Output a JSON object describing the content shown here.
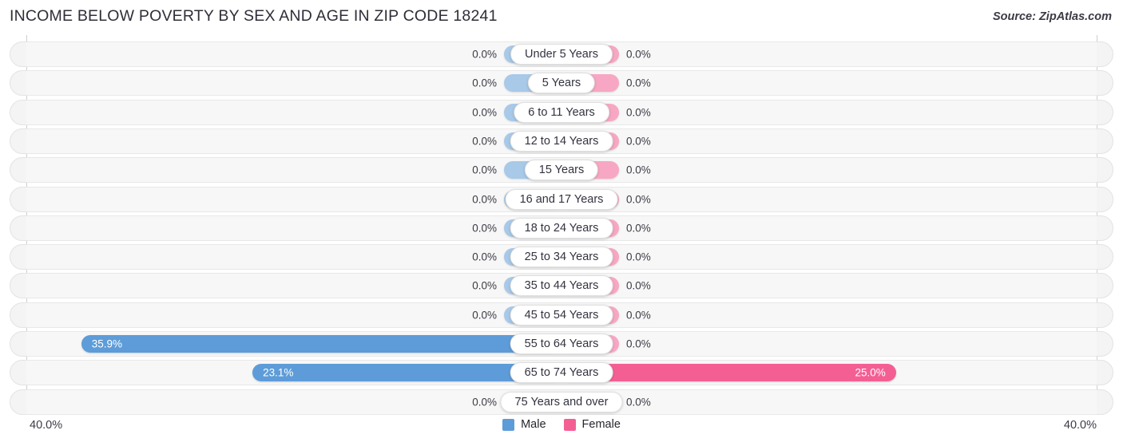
{
  "header": {
    "title": "INCOME BELOW POVERTY BY SEX AND AGE IN ZIP CODE 18241",
    "source": "Source: ZipAtlas.com"
  },
  "legend": {
    "male_label": "Male",
    "female_label": "Female",
    "male_color": "#5d9cd8",
    "female_color": "#f45f93"
  },
  "axis": {
    "left_tick": "40.0%",
    "right_tick": "40.0%",
    "max_percent": 40.0
  },
  "colors": {
    "male_full": "#5d9cd8",
    "male_lite": "#a8c9e8",
    "female_full": "#f45f93",
    "female_lite": "#f7a7c3",
    "track": "#f4f4f4",
    "title_text": "#2e2e38"
  },
  "chart_data": {
    "type": "bar",
    "subtype": "diverging-tornado",
    "title": "INCOME BELOW POVERTY BY SEX AND AGE IN ZIP CODE 18241",
    "xlabel": "",
    "ylabel": "",
    "xlim": [
      -40.0,
      40.0
    ],
    "grid": false,
    "legend_position": "bottom-center",
    "axis_tick_labels": [
      "40.0%",
      "40.0%"
    ],
    "categories": [
      "Under 5 Years",
      "5 Years",
      "6 to 11 Years",
      "12 to 14 Years",
      "15 Years",
      "16 and 17 Years",
      "18 to 24 Years",
      "25 to 34 Years",
      "35 to 44 Years",
      "45 to 54 Years",
      "55 to 64 Years",
      "65 to 74 Years",
      "75 Years and over"
    ],
    "series": [
      {
        "name": "Male",
        "color": "#5d9cd8",
        "direction": "left",
        "values": [
          0.0,
          0.0,
          0.0,
          0.0,
          0.0,
          0.0,
          0.0,
          0.0,
          0.0,
          0.0,
          35.9,
          23.1,
          0.0
        ],
        "labels": [
          "0.0%",
          "0.0%",
          "0.0%",
          "0.0%",
          "0.0%",
          "0.0%",
          "0.0%",
          "0.0%",
          "0.0%",
          "0.0%",
          "35.9%",
          "23.1%",
          "0.0%"
        ]
      },
      {
        "name": "Female",
        "color": "#f45f93",
        "direction": "right",
        "values": [
          0.0,
          0.0,
          0.0,
          0.0,
          0.0,
          0.0,
          0.0,
          0.0,
          0.0,
          0.0,
          0.0,
          25.0,
          0.0
        ],
        "labels": [
          "0.0%",
          "0.0%",
          "0.0%",
          "0.0%",
          "0.0%",
          "0.0%",
          "0.0%",
          "0.0%",
          "0.0%",
          "0.0%",
          "0.0%",
          "25.0%",
          "0.0%"
        ]
      }
    ]
  },
  "rows": [
    {
      "category": "Under 5 Years",
      "male": 0.0,
      "male_label": "0.0%",
      "female": 0.0,
      "female_label": "0.0%"
    },
    {
      "category": "5 Years",
      "male": 0.0,
      "male_label": "0.0%",
      "female": 0.0,
      "female_label": "0.0%"
    },
    {
      "category": "6 to 11 Years",
      "male": 0.0,
      "male_label": "0.0%",
      "female": 0.0,
      "female_label": "0.0%"
    },
    {
      "category": "12 to 14 Years",
      "male": 0.0,
      "male_label": "0.0%",
      "female": 0.0,
      "female_label": "0.0%"
    },
    {
      "category": "15 Years",
      "male": 0.0,
      "male_label": "0.0%",
      "female": 0.0,
      "female_label": "0.0%"
    },
    {
      "category": "16 and 17 Years",
      "male": 0.0,
      "male_label": "0.0%",
      "female": 0.0,
      "female_label": "0.0%"
    },
    {
      "category": "18 to 24 Years",
      "male": 0.0,
      "male_label": "0.0%",
      "female": 0.0,
      "female_label": "0.0%"
    },
    {
      "category": "25 to 34 Years",
      "male": 0.0,
      "male_label": "0.0%",
      "female": 0.0,
      "female_label": "0.0%"
    },
    {
      "category": "35 to 44 Years",
      "male": 0.0,
      "male_label": "0.0%",
      "female": 0.0,
      "female_label": "0.0%"
    },
    {
      "category": "45 to 54 Years",
      "male": 0.0,
      "male_label": "0.0%",
      "female": 0.0,
      "female_label": "0.0%"
    },
    {
      "category": "55 to 64 Years",
      "male": 35.9,
      "male_label": "35.9%",
      "female": 0.0,
      "female_label": "0.0%"
    },
    {
      "category": "65 to 74 Years",
      "male": 23.1,
      "male_label": "23.1%",
      "female": 25.0,
      "female_label": "25.0%"
    },
    {
      "category": "75 Years and over",
      "male": 0.0,
      "male_label": "0.0%",
      "female": 0.0,
      "female_label": "0.0%"
    }
  ]
}
